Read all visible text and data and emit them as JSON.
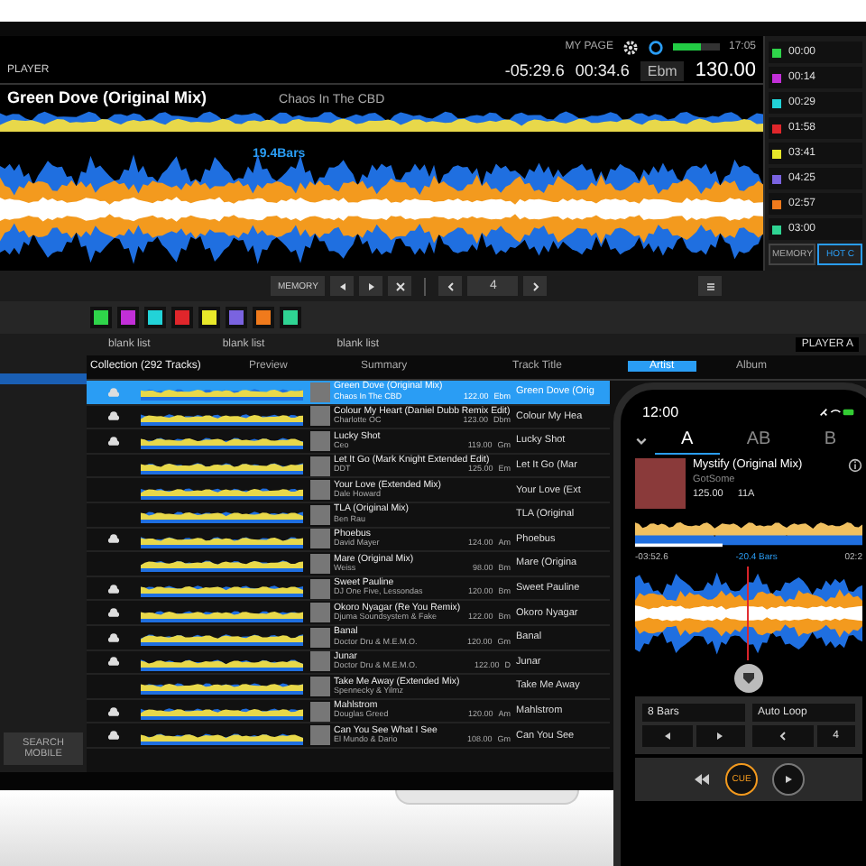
{
  "top_bar": {
    "my_page": "MY PAGE",
    "remaining_time": "-05:29.6",
    "elapsed_time": "00:34.6",
    "key": "Ebm",
    "bpm": "130.00",
    "clock": "17:05"
  },
  "deck": {
    "player": "PLAYER",
    "artist": "Chaos In The CBD",
    "title": "Green Dove (Original Mix)",
    "beat_countdown": "19.4Bars"
  },
  "hot_cue_list": [
    {
      "time": "00:00",
      "color": "#2fd44a"
    },
    {
      "time": "00:14",
      "color": "#c22fd8"
    },
    {
      "time": "00:29",
      "color": "#22d3d8"
    },
    {
      "time": "01:58",
      "color": "#e0262b"
    },
    {
      "time": "03:41",
      "color": "#e8e82a"
    },
    {
      "time": "04:25",
      "color": "#7a63e0"
    },
    {
      "time": "02:57",
      "color": "#f07a1c"
    },
    {
      "time": "03:00",
      "color": "#2fd493"
    }
  ],
  "hot_cue_tabs": [
    {
      "label": "MEMORY",
      "selected": false
    },
    {
      "label": "HOT C",
      "selected": true
    }
  ],
  "transport": {
    "memory": "MEMORY",
    "loop_beats": "4"
  },
  "hot_cue_pads": [
    {
      "color": "#2fd44a"
    },
    {
      "color": "#c22fd8"
    },
    {
      "color": "#22d3d8"
    },
    {
      "color": "#e0262b"
    },
    {
      "color": "#e8e82a"
    },
    {
      "color": "#7a63e0"
    },
    {
      "color": "#f07a1c"
    },
    {
      "color": "#2fd493"
    }
  ],
  "browser": {
    "playlist_tabs": [
      "blank list",
      "blank list",
      "blank list"
    ],
    "player": "PLAYER A",
    "collection": "Collection (292 Tracks)",
    "columns": [
      "Preview",
      "Summary",
      "Track Title",
      "Artist",
      "Album"
    ],
    "search_mobile": "SEARCH MOBILE",
    "rows": [
      {
        "selected": true,
        "cloud": true,
        "title": "Green Dove (Original Mix)",
        "artist": "Chaos In The CBD",
        "bpm": "122.00",
        "key": "Ebm",
        "track_title": "Green Dove (Orig"
      },
      {
        "selected": false,
        "cloud": true,
        "title": "Colour My Heart (Daniel Dubb Remix Edit)",
        "artist": "Charlotte OC",
        "bpm": "123.00",
        "key": "Dbm",
        "track_title": "Colour My Hea"
      },
      {
        "selected": false,
        "cloud": true,
        "title": "Lucky Shot",
        "artist": "Ceo",
        "bpm": "119.00",
        "key": "Gm",
        "track_title": "Lucky Shot"
      },
      {
        "selected": false,
        "cloud": false,
        "title": "Let It Go (Mark Knight Extended Edit)",
        "artist": "DDT",
        "bpm": "125.00",
        "key": "Em",
        "track_title": "Let It Go (Mar"
      },
      {
        "selected": false,
        "cloud": false,
        "title": "Your Love (Extended Mix)",
        "artist": "Dale Howard",
        "bpm": "",
        "key": "",
        "track_title": "Your Love (Ext"
      },
      {
        "selected": false,
        "cloud": false,
        "title": "TLA (Original Mix)",
        "artist": "Ben Rau",
        "bpm": "",
        "key": "",
        "track_title": "TLA (Original"
      },
      {
        "selected": false,
        "cloud": true,
        "title": "Phoebus",
        "artist": "David Mayer",
        "bpm": "124.00",
        "key": "Am",
        "track_title": "Phoebus"
      },
      {
        "selected": false,
        "cloud": false,
        "title": "Mare (Original Mix)",
        "artist": "Weiss",
        "bpm": "98.00",
        "key": "Bm",
        "track_title": "Mare (Origina"
      },
      {
        "selected": false,
        "cloud": true,
        "title": "Sweet Pauline",
        "artist": "DJ One Five, Lessondas",
        "bpm": "120.00",
        "key": "Bm",
        "track_title": "Sweet Pauline"
      },
      {
        "selected": false,
        "cloud": true,
        "title": "Okoro Nyagar (Re You Remix)",
        "artist": "Djuma Soundsystem & Fake",
        "bpm": "122.00",
        "key": "Bm",
        "track_title": "Okoro Nyagar"
      },
      {
        "selected": false,
        "cloud": true,
        "title": "Banal",
        "artist": "Doctor Dru & M.E.M.O.",
        "bpm": "120.00",
        "key": "Gm",
        "track_title": "Banal"
      },
      {
        "selected": false,
        "cloud": true,
        "title": "Junar",
        "artist": "Doctor Dru & M.E.M.O.",
        "bpm": "122.00",
        "key": "D",
        "track_title": "Junar"
      },
      {
        "selected": false,
        "cloud": false,
        "title": "Take Me Away (Extended Mix)",
        "artist": "Spennecky & Yilmz",
        "bpm": "",
        "key": "",
        "track_title": "Take Me Away"
      },
      {
        "selected": false,
        "cloud": true,
        "title": "Mahlstrom",
        "artist": "Douglas Greed",
        "bpm": "120.00",
        "key": "Am",
        "track_title": "Mahlstrom"
      },
      {
        "selected": false,
        "cloud": true,
        "title": "Can You See What I See",
        "artist": "El Mundo & Dario",
        "bpm": "108.00",
        "key": "Gm",
        "track_title": "Can You See"
      }
    ]
  },
  "phone": {
    "time": "12:00",
    "deck_tabs": [
      {
        "label": "A",
        "selected": true
      },
      {
        "label": "AB",
        "selected": false
      },
      {
        "label": "B",
        "selected": false
      }
    ],
    "title": "Mystify (Original Mix)",
    "artist": "GotSome",
    "bpm": "125.00",
    "key": "11A",
    "beat_countdown": "-20.4 Bars",
    "remaining_time": "-03:52.6",
    "elapsed_time": "02:2",
    "loop_length": "8 Bars",
    "loop_mode": "Auto Loop",
    "loop_beats": "4",
    "cue": "CUE"
  }
}
